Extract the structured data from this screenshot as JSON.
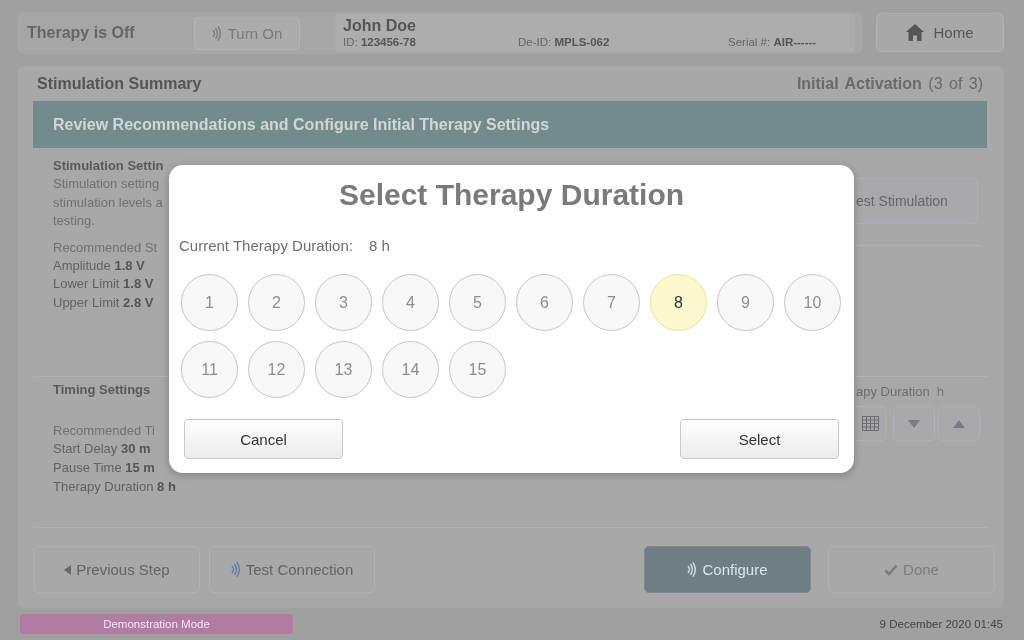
{
  "status": {
    "therapy_state": "Therapy is Off",
    "turn_on_button": {
      "label": "Turn On",
      "disabled": true
    }
  },
  "patient": {
    "name": "John Doe",
    "fields": [
      "ID: **123456-78**",
      "De-ID: **MPLS-062**",
      "Serial #: **AIR------**"
    ]
  },
  "home_button": {
    "label": "Home"
  },
  "panel": {
    "title": "Stimulation Summary",
    "step": "**Initial Activation** (3 of 3)",
    "banner": "Review Recommendations and Configure Initial Therapy Settings"
  },
  "stimulation_settings": {
    "heading": "Stimulation Settin",
    "description": [
      "Stimulation setting",
      "stimulation levels a",
      "testing."
    ],
    "recommended_heading": "Recommended St",
    "values": [
      "Amplitude **1.8 V**",
      "Lower Limit **1.8 V**",
      "Upper Limit **2.8 V**"
    ],
    "test_button": "est Stimulation"
  },
  "timing_settings": {
    "heading": "Timing Settings",
    "recommended_heading": "Recommended Ti",
    "values": [
      "Start Delay **30 m**",
      "Pause Time **15 m**",
      "Therapy Duration **8 h**"
    ],
    "duration_label": "apy Duration",
    "duration_unit": "h"
  },
  "footer_buttons": [
    {
      "label": "Previous Step",
      "kind": "back",
      "disabled": false
    },
    {
      "label": "Test Connection",
      "kind": "connect",
      "disabled": false
    },
    {
      "label": "Configure",
      "kind": "send",
      "disabled": false
    },
    {
      "label": "Done",
      "kind": "confirm",
      "disabled": true
    }
  ],
  "demo_banner": "Demonstration Mode",
  "datetime": "9 December 2020 01:45",
  "dialog": {
    "title": "Select Therapy Duration",
    "current_label": "Current Therapy Duration:",
    "current_value": "8 h",
    "options": [
      {
        "label": "1",
        "selected": false
      },
      {
        "label": "2",
        "selected": false
      },
      {
        "label": "3",
        "selected": false
      },
      {
        "label": "4",
        "selected": false
      },
      {
        "label": "5",
        "selected": false
      },
      {
        "label": "6",
        "selected": false
      },
      {
        "label": "7",
        "selected": false
      },
      {
        "label": "8",
        "selected": true
      },
      {
        "label": "9",
        "selected": false
      },
      {
        "label": "10",
        "selected": false
      },
      {
        "label": "11",
        "selected": false
      },
      {
        "label": "12",
        "selected": false
      },
      {
        "label": "13",
        "selected": false
      },
      {
        "label": "14",
        "selected": false
      },
      {
        "label": "15",
        "selected": false
      }
    ],
    "buttons": [
      "Cancel",
      "Select"
    ]
  }
}
